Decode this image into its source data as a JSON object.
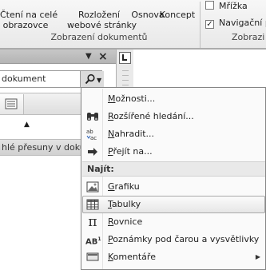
{
  "ribbon": {
    "buttons": [
      {
        "label": "Čtení na celé\nobrazovce"
      },
      {
        "label": "Rozložení\nwebové stránky"
      },
      {
        "label": "Osnova"
      },
      {
        "label": "Koncept"
      }
    ],
    "group_title": "Zobrazení dokumentů",
    "checkboxes": [
      {
        "label": "Mřížka",
        "checked": false
      },
      {
        "label": "Navigační p",
        "checked": true
      }
    ],
    "group2_title": "Zobrazi"
  },
  "nav_pane": {
    "search_value": "dokument",
    "message": "hlé přesuny v doku"
  },
  "menu": {
    "items_top": [
      {
        "label": "Možnosti...",
        "icon": "none"
      },
      {
        "label": "Rozšířené hledání...",
        "icon": "binoculars-icon"
      },
      {
        "label": "Nahradit...",
        "icon": "replace-icon"
      },
      {
        "label": "Přejít na...",
        "icon": "arrow-right-icon"
      }
    ],
    "section_label": "Najít:",
    "items_bottom": [
      {
        "label": "Grafiku",
        "icon": "picture-icon"
      },
      {
        "label": "Tabulky",
        "icon": "table-icon",
        "highlighted": true
      },
      {
        "label": "Rovnice",
        "icon": "pi-icon"
      },
      {
        "label": "Poznámky pod čarou a vysvětlivky",
        "icon": "footnote-icon"
      },
      {
        "label": "Komentáře",
        "icon": "comment-icon",
        "submenu": true
      }
    ]
  }
}
